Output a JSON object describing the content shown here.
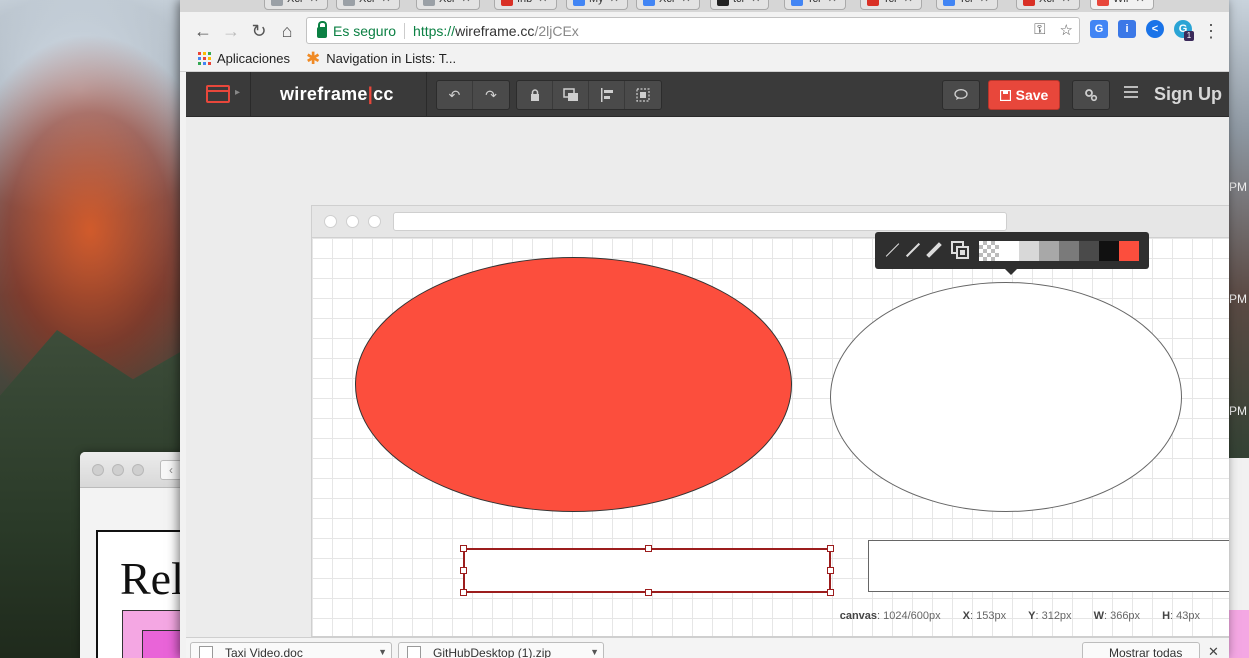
{
  "desktop": {
    "clock_labels": [
      "PM",
      "PM",
      "PM"
    ],
    "background_doc_title": "Rel"
  },
  "browser": {
    "tabs": [
      {
        "label": "Xcr",
        "favicon_color": "#9aa0a6"
      },
      {
        "label": "Xcr",
        "favicon_color": "#9aa0a6"
      },
      {
        "label": "Xcr",
        "favicon_color": "#9aa0a6"
      },
      {
        "label": "Inb",
        "favicon_color": "#d93025"
      },
      {
        "label": "My",
        "favicon_color": "#4285f4"
      },
      {
        "label": "Xcr",
        "favicon_color": "#4285f4"
      },
      {
        "label": "tcr",
        "favicon_color": "#222222"
      },
      {
        "label": "Tcr",
        "favicon_color": "#4285f4"
      },
      {
        "label": "Tcr",
        "favicon_color": "#d93025"
      },
      {
        "label": "Tcr",
        "favicon_color": "#4285f4"
      },
      {
        "label": "Xcr",
        "favicon_color": "#d93025"
      },
      {
        "label": "Wir",
        "favicon_color": "#e8473b",
        "active": true
      }
    ],
    "nav": {
      "back_icon": "←",
      "forward_icon": "→",
      "reload_icon": "↻",
      "home_icon": "⌂"
    },
    "address": {
      "secure_label": "Es seguro",
      "scheme": "https://",
      "host": "wireframe.cc",
      "path": "/2ljCEx",
      "key_icon": "⚿",
      "star_icon": "☆"
    },
    "extensions": [
      {
        "name": "translate-icon",
        "glyph": "G",
        "color": "#4285f4"
      },
      {
        "name": "extension-i-icon",
        "glyph": "i",
        "color": "#3b78e7"
      },
      {
        "name": "share-icon",
        "glyph": "<",
        "color": "#1a73e8"
      },
      {
        "name": "grammar-icon",
        "glyph": "G",
        "color": "#2aa4d5",
        "badge": "1"
      }
    ],
    "menu_icon": "⋮",
    "bookmarks": [
      {
        "label": "Aplicaciones"
      },
      {
        "label": "Navigation in Lists: T..."
      }
    ]
  },
  "app": {
    "brand_part1": "wireframe",
    "brand_bar": "|",
    "brand_part2": "cc",
    "undo_icon": "↶",
    "redo_icon": "↷",
    "lock_icon": "🔒",
    "save_label": "Save",
    "signup_label": "Sign Up",
    "accent": "#e8473b"
  },
  "canvas": {
    "status": {
      "canvas_label": "canvas",
      "canvas_value": "1024/600px",
      "x_label": "X",
      "x_value": "153px",
      "y_label": "Y",
      "y_value": "312px",
      "w_label": "W",
      "w_value": "366px",
      "h_label": "H",
      "h_value": "43px"
    },
    "shapes": [
      {
        "name": "red-ellipse",
        "fill": "#fc4e3d"
      },
      {
        "name": "white-ellipse",
        "fill": "#ffffff"
      },
      {
        "name": "selected-rectangle",
        "fill": "#ffffff"
      },
      {
        "name": "right-rectangle",
        "fill": "#ffffff"
      }
    ],
    "swatches": [
      "transparent",
      "#ffffff",
      "#d8d8d8",
      "#a8a8a8",
      "#7a7a7a",
      "#4a4a4a",
      "#111111",
      "#fc4e3d"
    ]
  },
  "downloads": {
    "items": [
      {
        "label": "Taxi Video.doc"
      },
      {
        "label": "GitHubDesktop (1).zip"
      }
    ],
    "show_all_label": "Mostrar todas",
    "close_icon": "✕"
  }
}
